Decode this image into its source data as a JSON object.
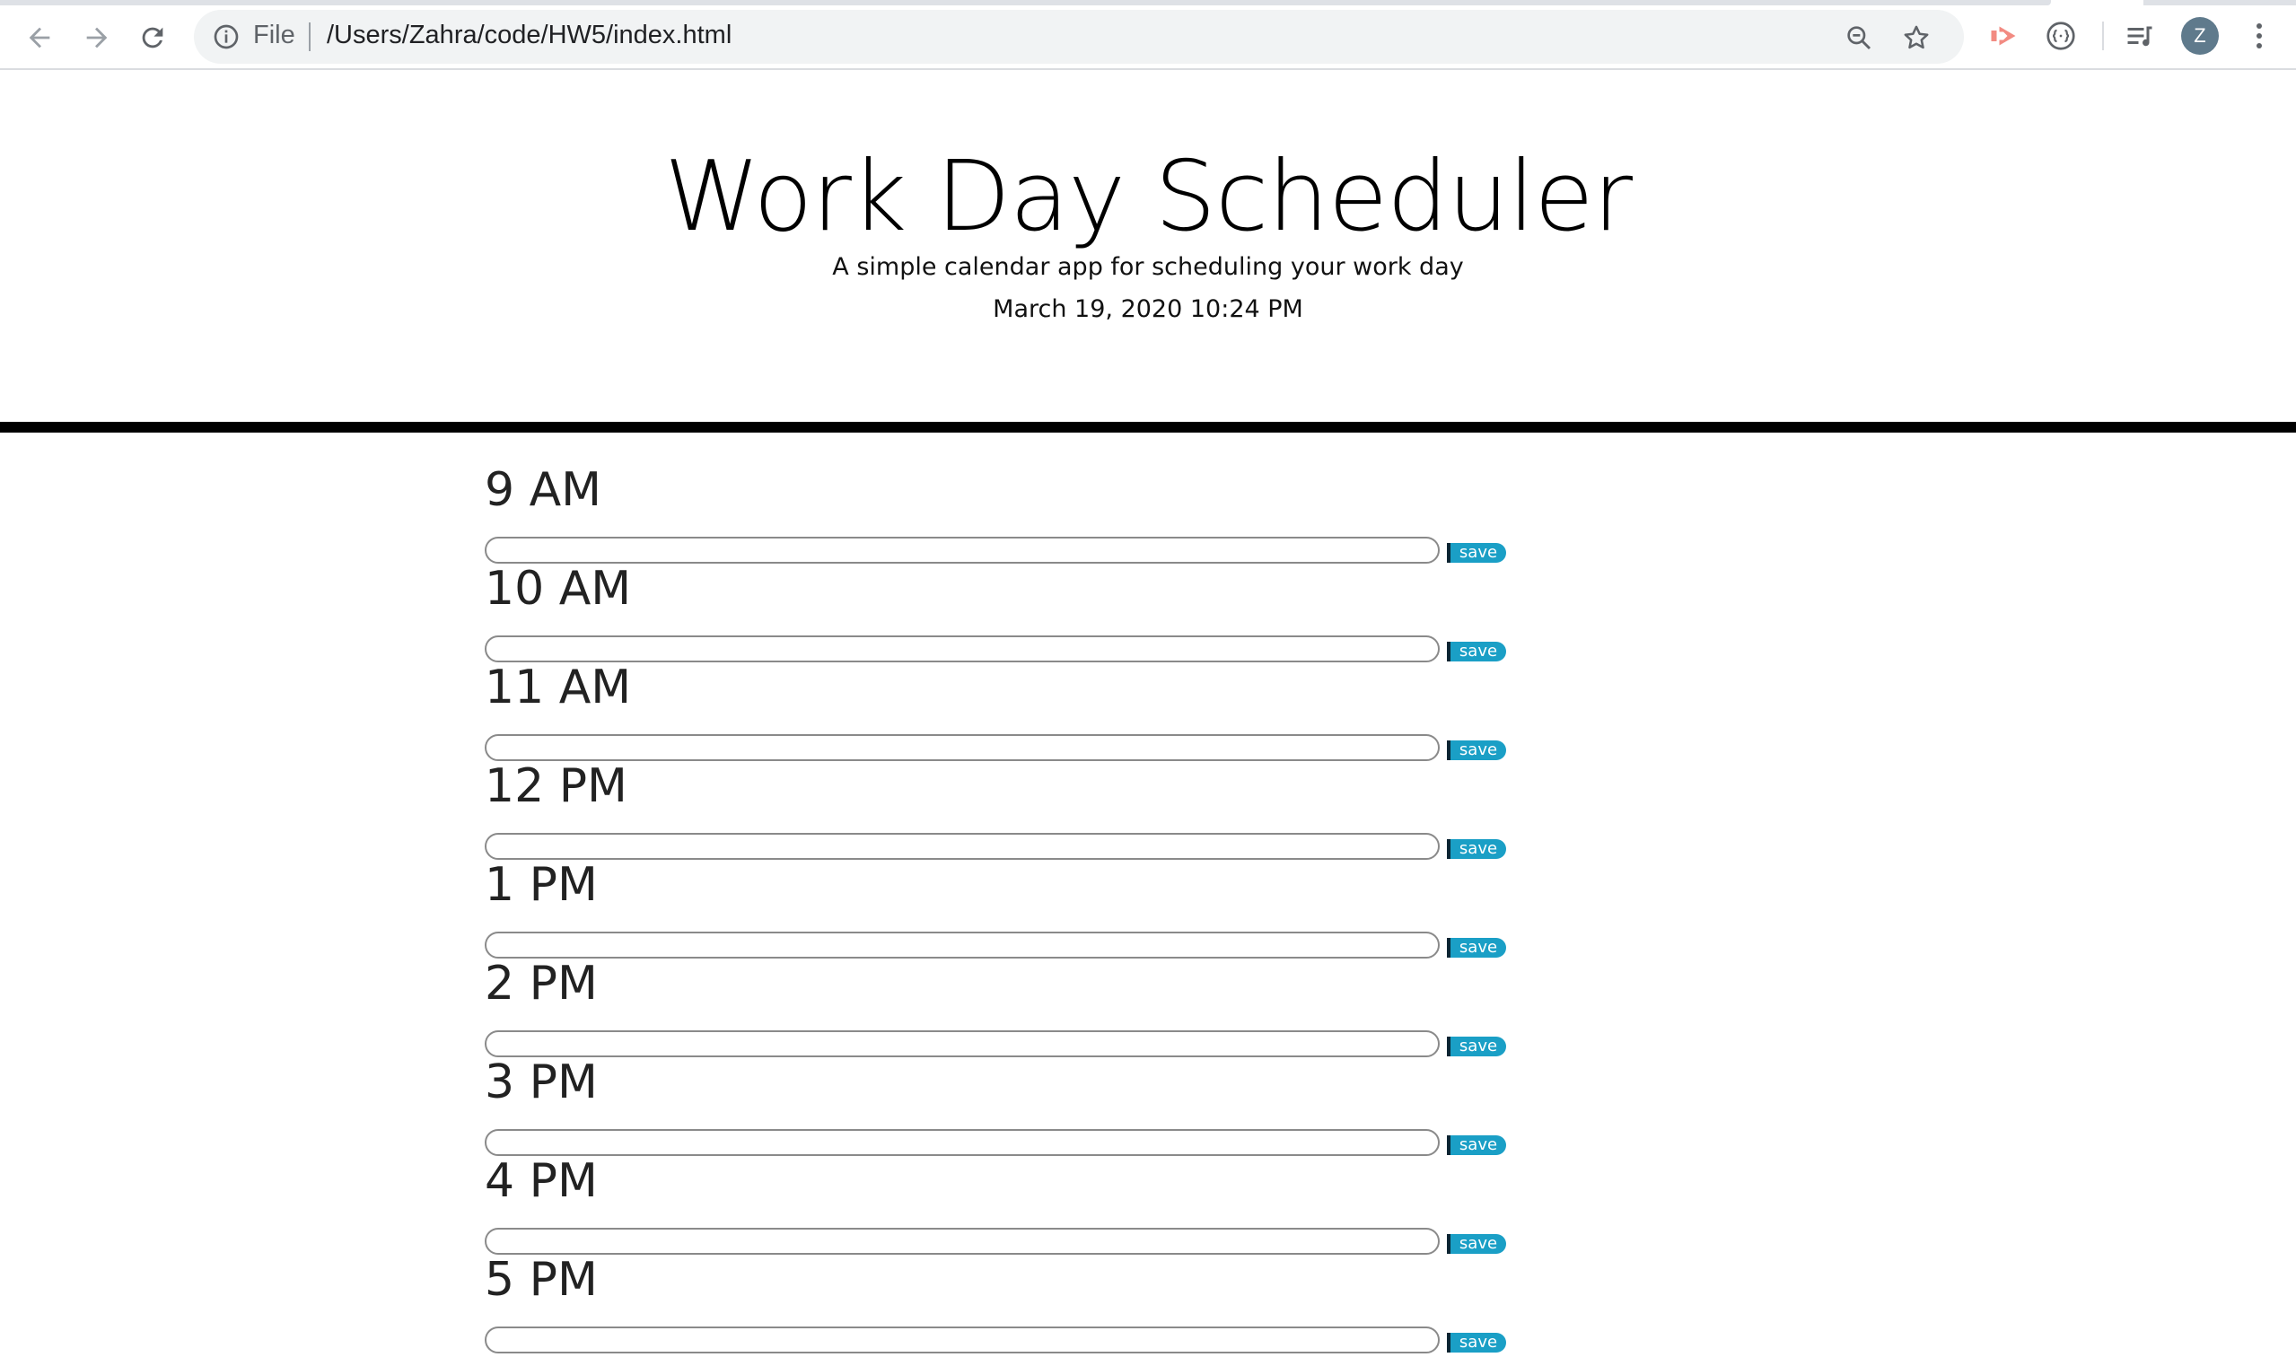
{
  "browser": {
    "scheme_label": "File",
    "url": "/Users/Zahra/code/HW5/index.html",
    "avatar_initial": "Z",
    "nav_icons": [
      "back-arrow-icon",
      "forward-arrow-icon",
      "reload-icon"
    ],
    "omnibox_icons": [
      "info-icon",
      "zoom-out-icon",
      "bookmark-star-icon"
    ],
    "extension_icons": [
      "extension-arrow-icon",
      "extension-brackets-icon",
      "media-queue-icon"
    ]
  },
  "header": {
    "title": "Work Day Scheduler",
    "subtitle": "A simple calendar app for scheduling your work day",
    "current_date": "March 19, 2020 10:24 PM"
  },
  "schedule": {
    "save_label": "save",
    "hours": [
      "9 AM",
      "10 AM",
      "11 AM",
      "12 PM",
      "1 PM",
      "2 PM",
      "3 PM",
      "4 PM",
      "5 PM"
    ]
  },
  "colors": {
    "save_button": "#1a9fc6",
    "header_divider": "#000000",
    "extension_accent": "#f28b82"
  }
}
